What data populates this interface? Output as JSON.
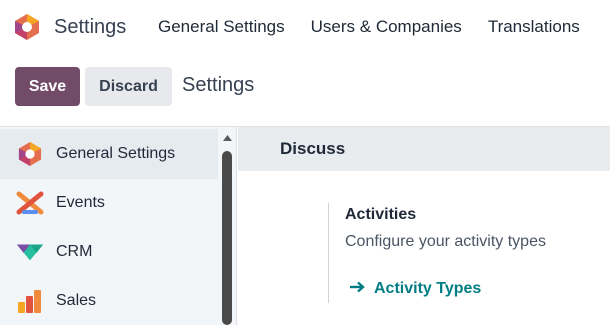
{
  "app": {
    "title": "Settings"
  },
  "nav": {
    "items": [
      {
        "label": "General Settings"
      },
      {
        "label": "Users & Companies"
      },
      {
        "label": "Translations"
      }
    ]
  },
  "toolbar": {
    "save_label": "Save",
    "discard_label": "Discard",
    "breadcrumb": "Settings"
  },
  "sidebar": {
    "items": [
      {
        "label": "General Settings",
        "icon": "settings-app-icon",
        "active": true
      },
      {
        "label": "Events",
        "icon": "events-app-icon",
        "active": false
      },
      {
        "label": "CRM",
        "icon": "crm-app-icon",
        "active": false
      },
      {
        "label": "Sales",
        "icon": "sales-app-icon",
        "active": false
      }
    ]
  },
  "main": {
    "section_title": "Discuss",
    "setting": {
      "title": "Activities",
      "description": "Configure your activity types",
      "link_label": "Activity Types",
      "link_icon": "arrow-right-icon"
    }
  },
  "colors": {
    "primary": "#714b67",
    "link": "#017e84",
    "sidebar_bg": "#f3f6f9",
    "section_header_bg": "#e9ecef"
  }
}
